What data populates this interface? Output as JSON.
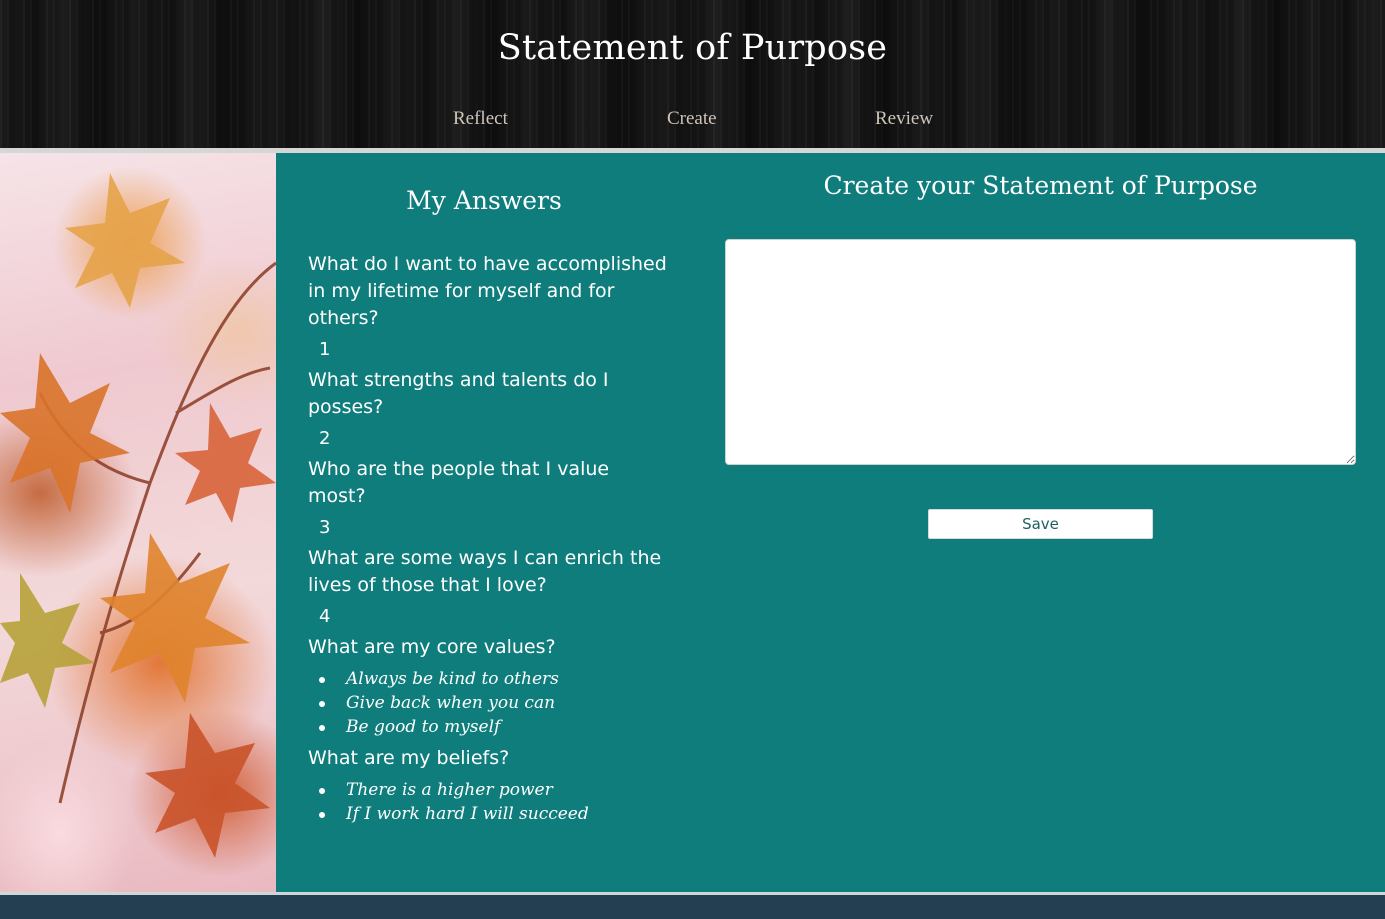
{
  "header": {
    "title": "Statement of Purpose",
    "nav": [
      {
        "label": "Reflect"
      },
      {
        "label": "Create"
      },
      {
        "label": "Review"
      }
    ]
  },
  "answers": {
    "title": "My Answers",
    "q1": {
      "question": "What do I want to have accomplished in my lifetime for myself and for others?",
      "answer": "1"
    },
    "q2": {
      "question": "What strengths and talents do I posses?",
      "answer": "2"
    },
    "q3": {
      "question": "Who are the people that I value most?",
      "answer": "3"
    },
    "q4": {
      "question": "What are some ways I can enrich the lives of those that I love?",
      "answer": "4"
    },
    "core_values": {
      "question": "What are my core values?",
      "items": [
        "Always be kind to others",
        "Give back when you can",
        "Be good to myself"
      ]
    },
    "beliefs": {
      "question": "What are my beliefs?",
      "items": [
        "There is a higher power",
        "If I work hard I will succeed"
      ]
    }
  },
  "create": {
    "title": "Create your Statement of Purpose",
    "statement_value": "",
    "save_label": "Save"
  },
  "colors": {
    "header_bg": "#141414",
    "main_bg": "#107d7d",
    "footer_bg": "#243f52",
    "nav_text": "#cfc4b9",
    "save_text": "#1d5f5f"
  },
  "images": {
    "side_image": "autumn-maple-leaves-photo"
  }
}
